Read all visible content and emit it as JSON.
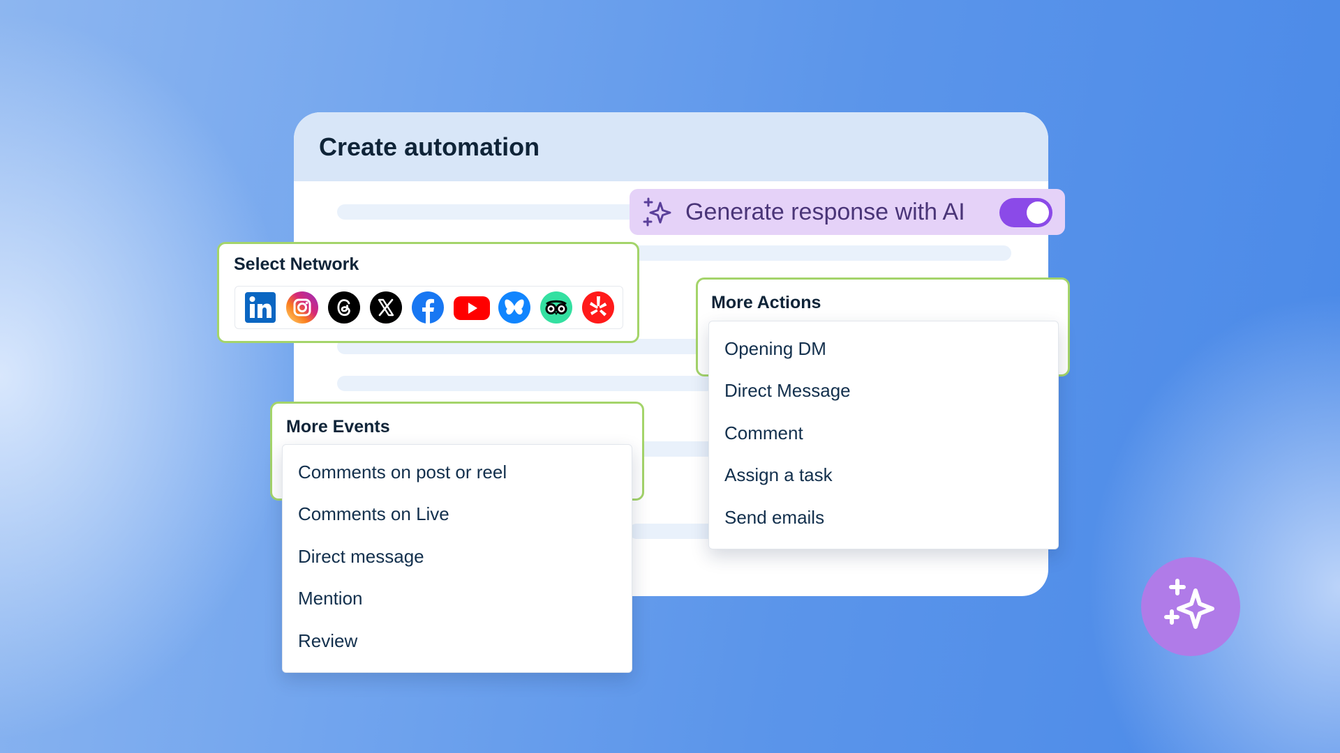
{
  "card": {
    "title": "Create automation"
  },
  "ai": {
    "label": "Generate response with AI",
    "toggle_on": true,
    "accent": "#8b4ae8"
  },
  "network": {
    "title": "Select Network",
    "icons": [
      "linkedin-icon",
      "instagram-icon",
      "threads-icon",
      "x-icon",
      "facebook-icon",
      "youtube-icon",
      "bluesky-icon",
      "tripadvisor-icon",
      "yelp-icon"
    ]
  },
  "actions": {
    "title": "More Actions",
    "items": [
      "Opening DM",
      "Direct Message",
      "Comment",
      "Assign a task",
      "Send emails"
    ]
  },
  "events": {
    "title": "More Events",
    "items": [
      "Comments on post or reel",
      "Comments on Live",
      "Direct message",
      "Mention",
      "Review"
    ]
  },
  "colors": {
    "panel_border": "#a4d46a",
    "fab": "#b07be8"
  }
}
